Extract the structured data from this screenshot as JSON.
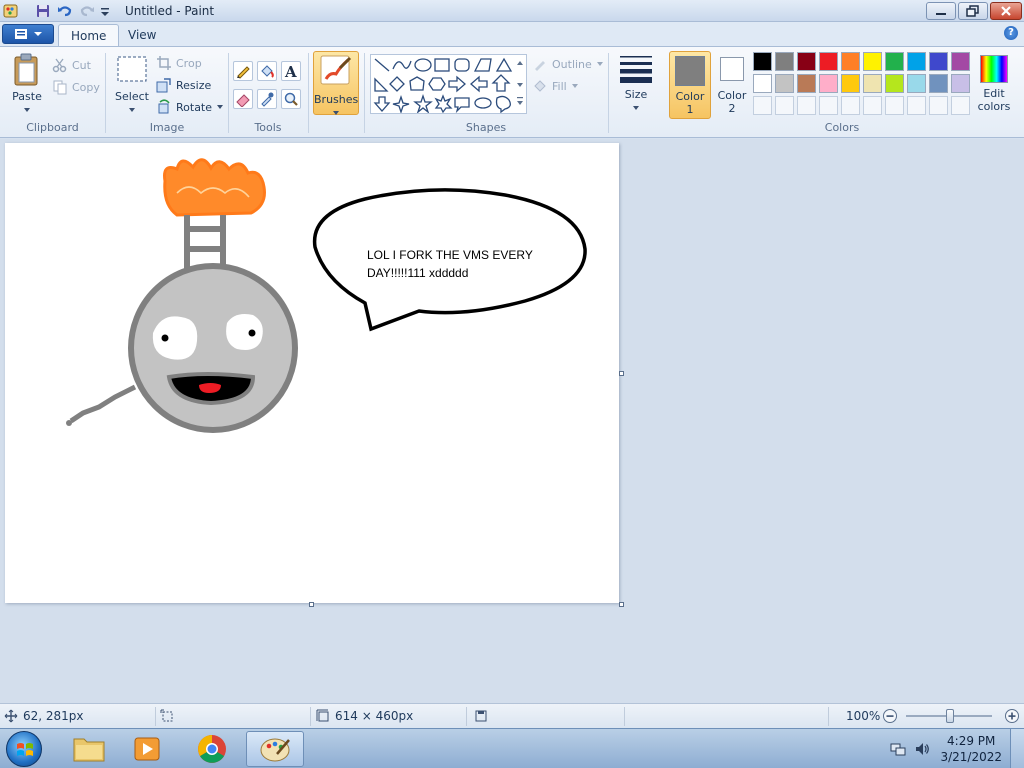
{
  "window": {
    "title": "Untitled - Paint"
  },
  "tabs": {
    "home": "Home",
    "view": "View"
  },
  "clipboard": {
    "paste": "Paste",
    "cut": "Cut",
    "copy": "Copy",
    "label": "Clipboard"
  },
  "image": {
    "select": "Select",
    "crop": "Crop",
    "resize": "Resize",
    "rotate": "Rotate",
    "label": "Image"
  },
  "tools": {
    "label": "Tools"
  },
  "brushes": {
    "label": "Brushes"
  },
  "shapes": {
    "outline": "Outline",
    "fill": "Fill",
    "label": "Shapes"
  },
  "size": {
    "label": "Size"
  },
  "colors": {
    "color1_label": "Color",
    "color1_num": "1",
    "color2_label": "Color",
    "color2_num": "2",
    "edit_label1": "Edit",
    "edit_label2": "colors",
    "label": "Colors",
    "color1_value": "#7f7f7f",
    "color2_value": "#ffffff",
    "palette_row1": [
      "#000000",
      "#7f7f7f",
      "#880015",
      "#ed1c24",
      "#ff7f27",
      "#fff200",
      "#22b14c",
      "#00a2e8",
      "#3f48cc",
      "#a349a4"
    ],
    "palette_row2": [
      "#ffffff",
      "#c3c3c3",
      "#b97a57",
      "#ffaec9",
      "#ffc90e",
      "#efe4b0",
      "#b5e61d",
      "#99d9ea",
      "#7092be",
      "#c8bfe7"
    ]
  },
  "canvas": {
    "speech_line1": "LOL I FORK THE VMS EVERY",
    "speech_line2": "DAY!!!!!111 xddddd"
  },
  "status": {
    "cursor_pos": "62, 281px",
    "image_size": "614 × 460px",
    "zoom": "100%"
  },
  "tray": {
    "time": "4:29 PM",
    "date": "3/21/2022"
  }
}
